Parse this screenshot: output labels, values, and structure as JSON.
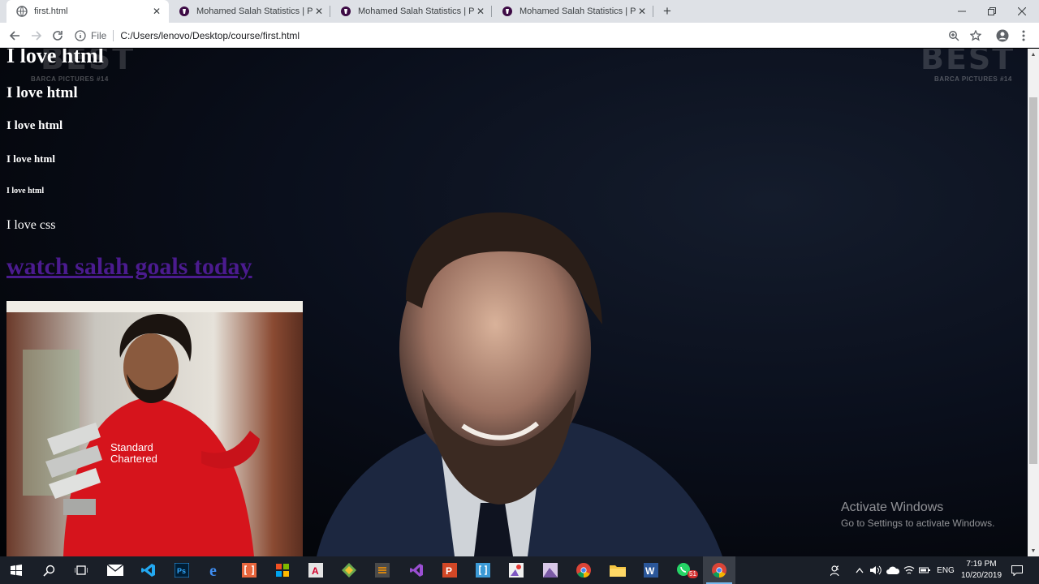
{
  "browser": {
    "tabs": [
      {
        "title": "first.html",
        "active": true
      },
      {
        "title": "Mohamed Salah Statistics | Prem",
        "active": false
      },
      {
        "title": "Mohamed Salah Statistics | Prem",
        "active": false
      },
      {
        "title": "Mohamed Salah Statistics | Prem",
        "active": false
      }
    ],
    "scheme_label": "File",
    "url": "C:/Users/lenovo/Desktop/course/first.html"
  },
  "page": {
    "h1": "I love html",
    "h2": "I love html",
    "h3": "I love html",
    "h4": "I love html",
    "h5": "I love html",
    "paragraph": "I love css",
    "link_text": "watch salah goals today",
    "link_color": "#4b1b8f",
    "background_watermark": "BEST",
    "background_caption": "BARCA PICTURES #14"
  },
  "activation": {
    "title": "Activate Windows",
    "subtitle": "Go to Settings to activate Windows."
  },
  "taskbar": {
    "language": "ENG",
    "time": "7:19 PM",
    "date": "10/20/2019",
    "whatsapp_badge": "51"
  }
}
